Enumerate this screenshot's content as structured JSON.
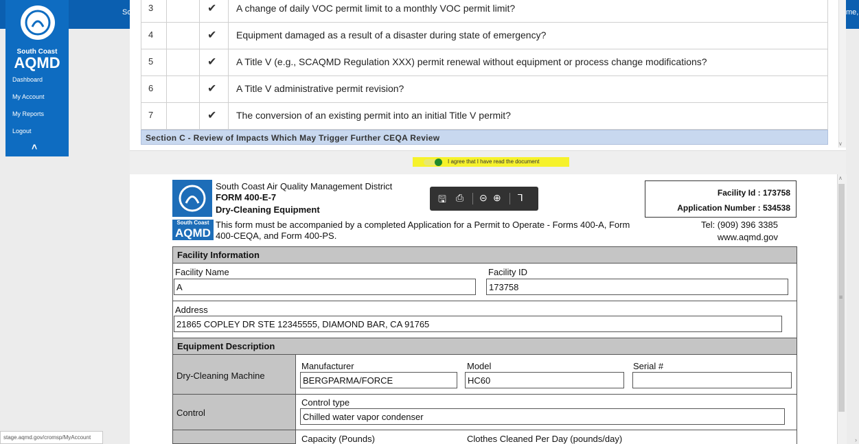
{
  "topbar": {
    "left_text": "So",
    "right_text": "me,"
  },
  "sidebar": {
    "brand_small": "South Coast",
    "brand_big": "AQMD",
    "items": [
      {
        "label": "Dashboard"
      },
      {
        "label": "My Account"
      },
      {
        "label": "My Reports"
      },
      {
        "label": "Logout"
      }
    ]
  },
  "status_url": "stage.aqmd.gov/cromsp/MyAccount",
  "questions": [
    {
      "num": "3",
      "check": "✔",
      "text": "A change of daily VOC permit limit to a monthly VOC permit limit?"
    },
    {
      "num": "4",
      "check": "✔",
      "text": "Equipment damaged as a result of a disaster during state of emergency?"
    },
    {
      "num": "5",
      "check": "✔",
      "text": "A Title V (e.g., SCAQMD Regulation XXX) permit renewal without equipment or process change modifications?"
    },
    {
      "num": "6",
      "check": "✔",
      "text": "A Title V administrative permit revision?"
    },
    {
      "num": "7",
      "check": "✔",
      "text": "The conversion of an existing permit into an initial Title V permit?"
    }
  ],
  "section_c": "Section C - Review of Impacts Which May Trigger Further CEQA Review",
  "agree": {
    "label": "I agree that I have read the document",
    "checked": true
  },
  "form": {
    "logo_small": "South Coast",
    "logo_big": "AQMD",
    "agency": "South Coast Air Quality Management District",
    "form_number": "FORM 400-E-7",
    "form_title": "Dry-Cleaning Equipment",
    "note": "This form must be accompanied by a completed Application for a Permit to Operate - Forms 400-A, Form 400-CEQA, and Form 400-PS.",
    "facility_id_label": "Facility Id :",
    "facility_id_value": "173758",
    "app_number_label": "Application Number :",
    "app_number_value": "534538",
    "tel": "Tel: (909) 396 3385",
    "web": "www.aqmd.gov",
    "facility_info": {
      "header": "Facility Information",
      "facility_name_label": "Facility Name",
      "facility_name_value": "A",
      "facility_id_label": "Facility ID",
      "facility_id_value": "173758",
      "address_label": "Address",
      "address_value": "21865 COPLEY DR STE 12345555, DIAMOND BAR, CA  91765"
    },
    "equipment": {
      "header": "Equipment Description",
      "row1_label": "Dry-Cleaning Machine",
      "manufacturer_label": "Manufacturer",
      "manufacturer_value": "BERGPARMA/FORCE",
      "model_label": "Model",
      "model_value": "HC60",
      "serial_label": "Serial #",
      "serial_value": "",
      "row2_label": "Control",
      "control_type_label": "Control type",
      "control_type_value": "Chilled water vapor condenser",
      "capacity_label": "Capacity (Pounds)",
      "clothes_label": "Clothes Cleaned Per Day (pounds/day)"
    }
  },
  "toolbar": {
    "save_icon": "save-icon",
    "print_icon": "print-icon",
    "zoom_out_icon": "zoom-out-icon",
    "zoom_in_icon": "zoom-in-icon",
    "pdf_icon": "pdf-icon"
  },
  "colors": {
    "topbar": "#0b5fb0",
    "sidebar": "#0e6cc1",
    "section_c_bg": "#c8d8ef",
    "highlight": "#f6f22b",
    "toggle_on": "#1f8a2a",
    "form_header_bg": "#c5c5c5"
  }
}
